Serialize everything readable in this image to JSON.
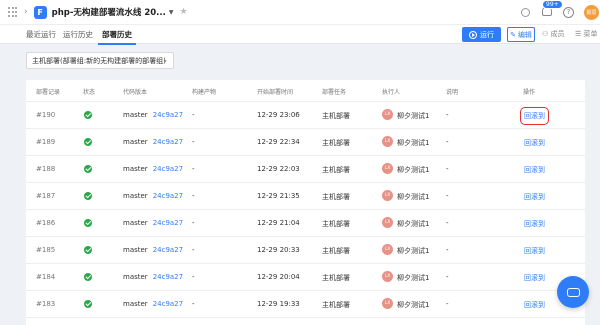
{
  "topbar": {
    "app_logo": "F",
    "pipeline_title": "php-无构建部署流水线 20...",
    "notification_badge": "99+",
    "help_glyph": "?",
    "user_avatar_text": "颜思"
  },
  "tabs": [
    {
      "label": "最近运行"
    },
    {
      "label": "运行历史"
    },
    {
      "label": "部署历史"
    }
  ],
  "actions": {
    "run_label": "运行",
    "edit_label": "编辑",
    "members_label": "成员",
    "menu_label": "菜单"
  },
  "filter": {
    "selected": "主机部署(部署组:新的无构建部署的部署组)"
  },
  "table": {
    "headers": [
      "部署记录",
      "状态",
      "代码版本",
      "构建产物",
      "开始部署时间",
      "部署任务",
      "执行人",
      "说明",
      "操作"
    ],
    "rows": [
      {
        "id": "#190",
        "branch": "master",
        "commit": "24c9a27",
        "artifact": "-",
        "time": "12-29 23:06",
        "task": "主机部署",
        "avatar": "LX",
        "executor": "柳夕测试1",
        "note": "-",
        "action": "回滚到",
        "highlight": true
      },
      {
        "id": "#189",
        "branch": "master",
        "commit": "24c9a27",
        "artifact": "-",
        "time": "12-29 22:34",
        "task": "主机部署",
        "avatar": "LX",
        "executor": "柳夕测试1",
        "note": "-",
        "action": "回滚到",
        "highlight": false
      },
      {
        "id": "#188",
        "branch": "master",
        "commit": "24c9a27",
        "artifact": "-",
        "time": "12-29 22:03",
        "task": "主机部署",
        "avatar": "LX",
        "executor": "柳夕测试1",
        "note": "-",
        "action": "回滚到",
        "highlight": false
      },
      {
        "id": "#187",
        "branch": "master",
        "commit": "24c9a27",
        "artifact": "-",
        "time": "12-29 21:35",
        "task": "主机部署",
        "avatar": "LX",
        "executor": "柳夕测试1",
        "note": "-",
        "action": "回滚到",
        "highlight": false
      },
      {
        "id": "#186",
        "branch": "master",
        "commit": "24c9a27",
        "artifact": "-",
        "time": "12-29 21:04",
        "task": "主机部署",
        "avatar": "LX",
        "executor": "柳夕测试1",
        "note": "-",
        "action": "回滚到",
        "highlight": false
      },
      {
        "id": "#185",
        "branch": "master",
        "commit": "24c9a27",
        "artifact": "-",
        "time": "12-29 20:33",
        "task": "主机部署",
        "avatar": "LX",
        "executor": "柳夕测试1",
        "note": "-",
        "action": "回滚到",
        "highlight": false
      },
      {
        "id": "#184",
        "branch": "master",
        "commit": "24c9a27",
        "artifact": "-",
        "time": "12-29 20:04",
        "task": "主机部署",
        "avatar": "LX",
        "executor": "柳夕测试1",
        "note": "-",
        "action": "回滚到",
        "highlight": false
      },
      {
        "id": "#183",
        "branch": "master",
        "commit": "24c9a27",
        "artifact": "-",
        "time": "12-29 19:33",
        "task": "主机部署",
        "avatar": "LX",
        "executor": "柳夕测试1",
        "note": "-",
        "action": "回滚到",
        "highlight": false
      }
    ]
  },
  "colors": {
    "accent": "#2f7df6",
    "success": "#2aa84a",
    "highlight_outline": "#e0302b",
    "executor_avatar": "#e79287"
  },
  "icons": [
    "apps-grid-icon",
    "chevron-right-icon",
    "star-icon",
    "search-icon",
    "bell-icon",
    "help-icon",
    "play-icon",
    "edit-icon",
    "members-icon",
    "menu-icon",
    "chevron-down-icon",
    "success-check-icon",
    "chat-icon"
  ]
}
